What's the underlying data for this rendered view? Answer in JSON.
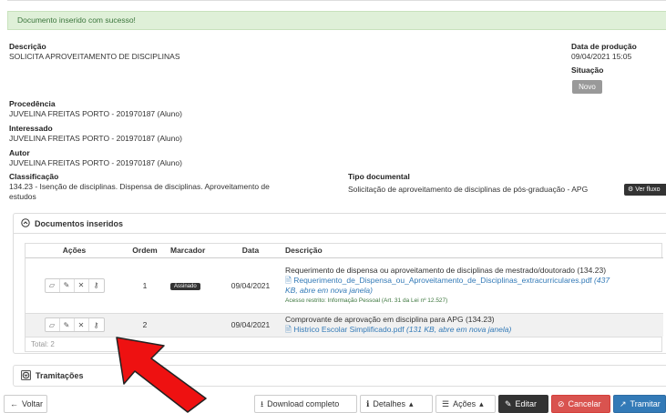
{
  "alert": {
    "text": "Documento inserido com sucesso!"
  },
  "fields": {
    "descricao_label": "Descrição",
    "descricao_value": "SOLICITA APROVEITAMENTO DE DISCIPLINAS",
    "data_producao_label": "Data de produção",
    "data_producao_value": "09/04/2021 15:05",
    "situacao_label": "Situação",
    "situacao_value": "Novo",
    "procedencia_label": "Procedência",
    "procedencia_value": "JUVELINA FREITAS PORTO - 201970187 (Aluno)",
    "interessado_label": "Interessado",
    "interessado_value": "JUVELINA FREITAS PORTO - 201970187 (Aluno)",
    "autor_label": "Autor",
    "autor_value": "JUVELINA FREITAS PORTO - 201970187 (Aluno)",
    "classificacao_label": "Classificação",
    "classificacao_value_line1": "134.23 - Isenção de disciplinas. Dispensa de disciplinas. Aproveitamento de",
    "classificacao_value_line2": "estudos",
    "tipo_documental_label": "Tipo documental",
    "tipo_documental_value": "Solicitação de aproveitamento de disciplinas de pós-graduação - APG",
    "ver_fluxo_label": "Ver fluxo"
  },
  "documentos": {
    "title": "Documentos inseridos",
    "columns": [
      "Ações",
      "Ordem",
      "Marcador",
      "Data",
      "Descrição"
    ],
    "rows": [
      {
        "ordem": "1",
        "marcador": "Assinado",
        "data": "09/04/2021",
        "descricao": "Requerimento de dispensa ou aproveitamento de disciplinas de mestrado/doutorado (134.23)",
        "arquivo": "Requerimento_de_Dispensa_ou_Aproveitamento_de_Disciplinas_extracurriculares.pdf",
        "arquivo_info_1": "(437",
        "arquivo_info_2": "KB, abre em nova janela)",
        "restricao": "Acesso restrito: Informação Pessoal (Art. 31 da Lei nº 12.527)"
      },
      {
        "ordem": "2",
        "marcador": "",
        "data": "09/04/2021",
        "descricao": "Comprovante de aprovação em disciplina para APG (134.23)",
        "arquivo": "Histrico Escolar Simplificado.pdf",
        "arquivo_info_1": "(131 KB, abre em nova janela)"
      }
    ],
    "total": "Total: 2"
  },
  "tramitacoes": {
    "title": "Tramitações"
  },
  "toolbar": {
    "voltar": "Voltar",
    "download": "Download completo",
    "detalhes": "Detalhes",
    "acoes": "Ações",
    "editar": "Editar",
    "cancelar": "Cancelar",
    "tramitar": "Tramitar"
  },
  "icons": {
    "folder": "folder-icon",
    "edit": "edit-icon",
    "remove": "remove-icon",
    "key": "key-icon",
    "file": "file-icon",
    "arrow": "red-arrow-annotation"
  }
}
